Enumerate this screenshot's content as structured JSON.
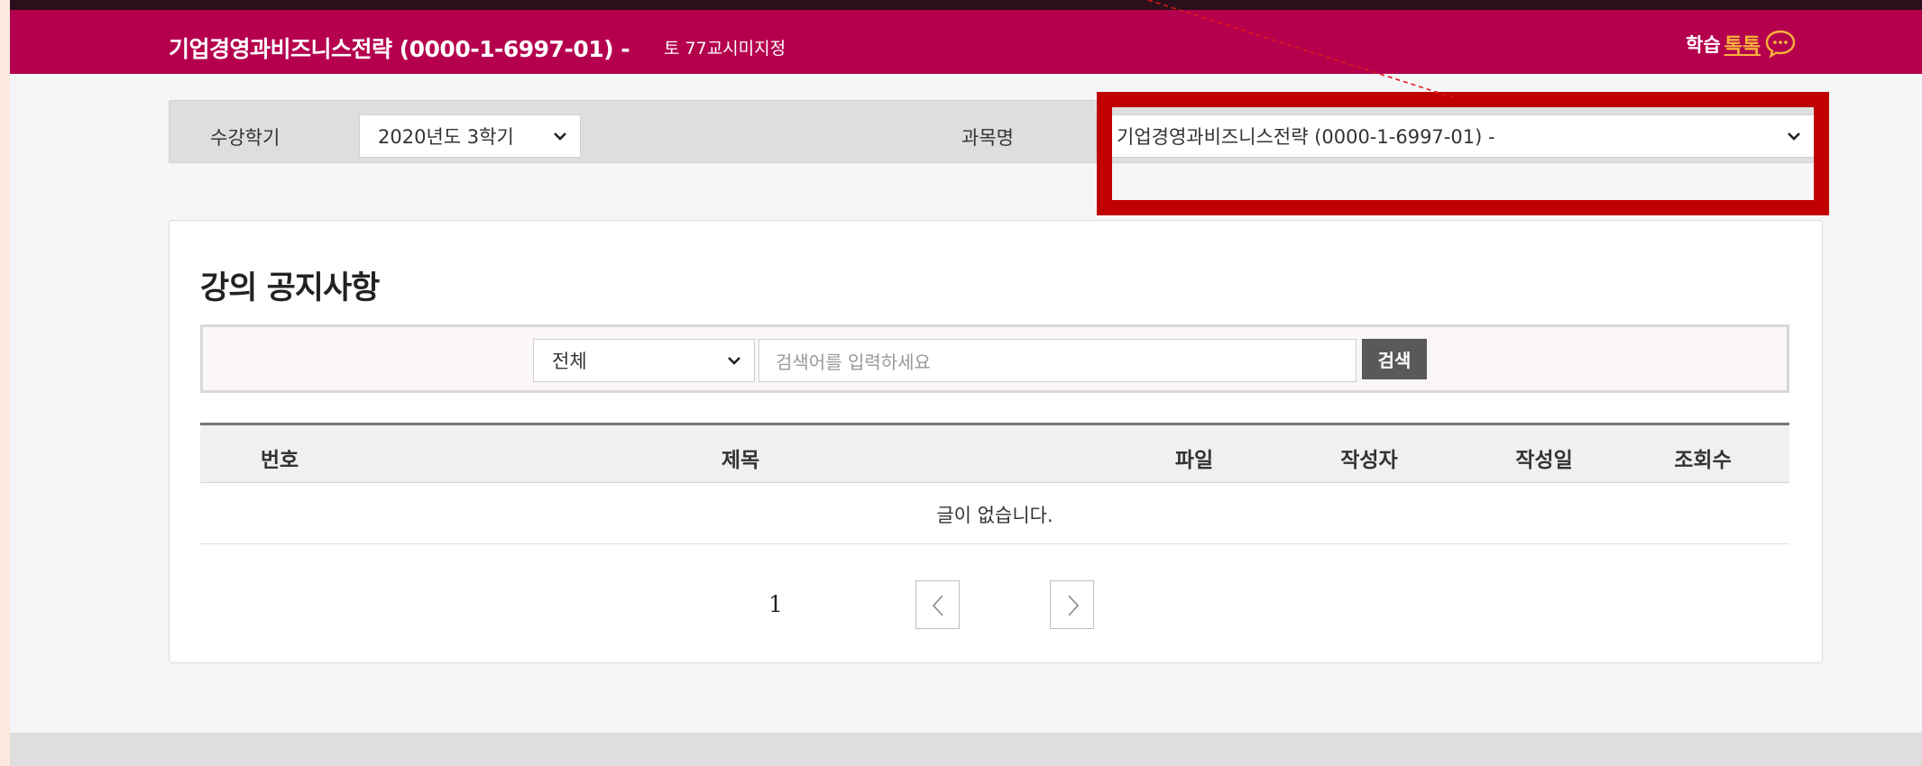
{
  "header": {
    "course_title": "기업경영과비즈니스전략 (0000-1-6997-01) -",
    "schedule": "토 77교시미지정",
    "talk_label": "학습",
    "talk_brand": "톡톡"
  },
  "filters": {
    "semester_label": "수강학기",
    "semester_value": "2020년도 3학기",
    "course_label": "과목명",
    "course_value": "기업경영과비즈니스전략 (0000-1-6997-01) -"
  },
  "notice": {
    "title": "강의 공지사항",
    "search": {
      "type_value": "전체",
      "placeholder": "검색어를 입력하세요",
      "button_label": "검색"
    },
    "columns": [
      "번호",
      "제목",
      "파일",
      "작성자",
      "작성일",
      "조회수"
    ],
    "empty_message": "글이 없습니다.",
    "pagination": {
      "current_page": "1"
    }
  },
  "colors": {
    "header_bg": "#b5004e",
    "highlight_border": "#c00000",
    "talk_accent": "#f7b23b",
    "search_button_bg": "#595959"
  },
  "icons": {
    "talk": "chat-bubble-icon",
    "dropdown": "chevron-down-icon",
    "prev": "chevron-left-icon",
    "next": "chevron-right-icon"
  }
}
